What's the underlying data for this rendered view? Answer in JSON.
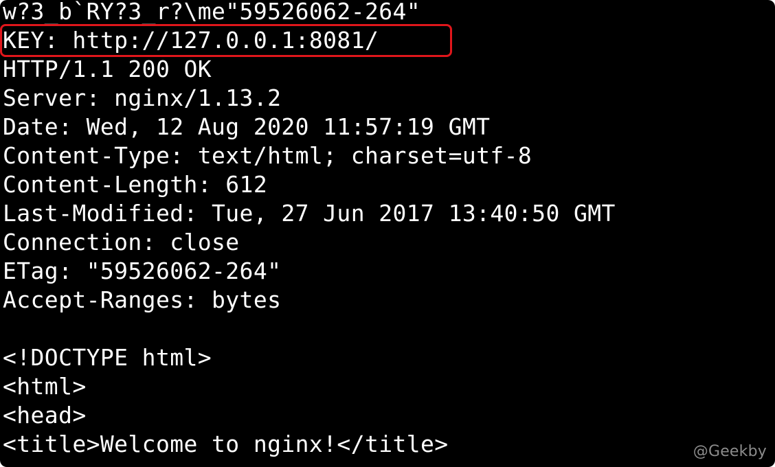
{
  "terminal": {
    "lines": [
      "w?3_b`RY?3_r?\\me\"59526062-264\"",
      "KEY: http://127.0.0.1:8081/",
      "HTTP/1.1 200 OK",
      "Server: nginx/1.13.2",
      "Date: Wed, 12 Aug 2020 11:57:19 GMT",
      "Content-Type: text/html; charset=utf-8",
      "Content-Length: 612",
      "Last-Modified: Tue, 27 Jun 2017 13:40:50 GMT",
      "Connection: close",
      "ETag: \"59526062-264\"",
      "Accept-Ranges: bytes",
      "",
      "<!DOCTYPE html>",
      "<html>",
      "<head>",
      "<title>Welcome to nginx!</title>"
    ],
    "highlight_color": "#e0161b",
    "background": "#000000",
    "text_color": "#ffffff"
  },
  "watermark": {
    "text": "@Geekby"
  }
}
